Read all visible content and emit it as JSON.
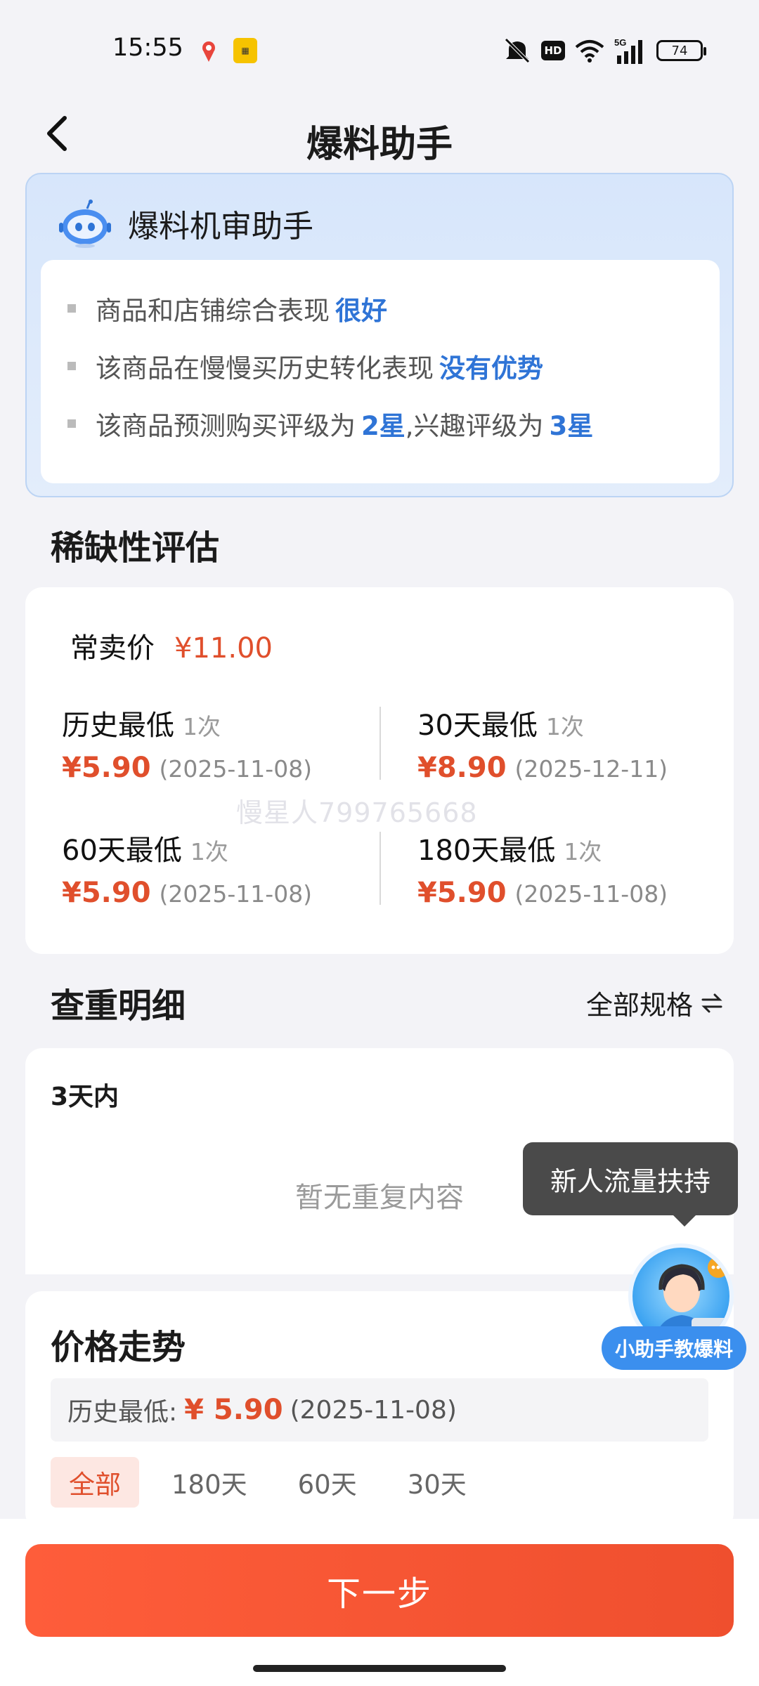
{
  "status_bar": {
    "time": "15:55",
    "battery": "74",
    "hd": "HD",
    "network": "5G",
    "icons": [
      "map-pin-icon",
      "app-icon",
      "mute-icon",
      "wifi-icon",
      "signal-icon",
      "battery-icon"
    ]
  },
  "header": {
    "title": "爆料助手",
    "back_icon": "chevron-left-icon"
  },
  "ai_card": {
    "title": "爆料机审助手",
    "lines": [
      {
        "text": "商品和店铺综合表现",
        "highlight": "很好",
        "tail": ""
      },
      {
        "text": "该商品在慢慢买历史转化表现",
        "highlight": "没有优势",
        "tail": ""
      },
      {
        "text": "该商品预测购买评级为",
        "highlight": "2星",
        "mid": ",兴趣评级为",
        "highlight2": "3星"
      }
    ]
  },
  "scarcity": {
    "title": "稀缺性评估",
    "regular_label": "常卖价",
    "regular_price": "¥11.00",
    "stats": [
      {
        "label": "历史最低",
        "count": "1次",
        "price": "¥5.90",
        "date": "(2025-11-08)"
      },
      {
        "label": "30天最低",
        "count": "1次",
        "price": "¥8.90",
        "date": "(2025-12-11)"
      },
      {
        "label": "60天最低",
        "count": "1次",
        "price": "¥5.90",
        "date": "(2025-11-08)"
      },
      {
        "label": "180天最低",
        "count": "1次",
        "price": "¥5.90",
        "date": "(2025-11-08)"
      }
    ],
    "watermark": "慢星人799765668"
  },
  "duplicates": {
    "title": "查重明细",
    "spec_toggle": "全部规格",
    "period": "3天内",
    "empty_text": "暂无重复内容"
  },
  "tooltip": {
    "text": "新人流量扶持"
  },
  "assistant": {
    "label": "小助手教爆料"
  },
  "trend": {
    "title": "价格走势",
    "lowest_label": "历史最低:",
    "lowest_price": "¥ 5.90",
    "lowest_date": "(2025-11-08)",
    "tabs": [
      "全部",
      "180天",
      "60天",
      "30天"
    ],
    "active_tab": "全部"
  },
  "footer": {
    "next_label": "下一步"
  },
  "colors": {
    "accent": "#e04f2c",
    "blue": "#2f74d6",
    "button": "#fe5d3a"
  }
}
